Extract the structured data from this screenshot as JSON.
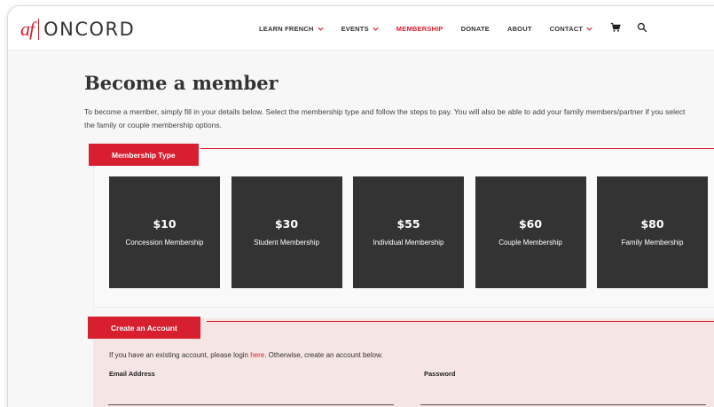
{
  "brand": {
    "logo_mark": "af",
    "logo_name": "ONCORD",
    "accent_color": "#d71f2f"
  },
  "nav": {
    "items": [
      {
        "label": "LEARN FRENCH",
        "dropdown": true,
        "active": false
      },
      {
        "label": "EVENTS",
        "dropdown": true,
        "active": false
      },
      {
        "label": "MEMBERSHIP",
        "dropdown": false,
        "active": true
      },
      {
        "label": "DONATE",
        "dropdown": false,
        "active": false
      },
      {
        "label": "ABOUT",
        "dropdown": false,
        "active": false
      },
      {
        "label": "CONTACT",
        "dropdown": true,
        "active": false
      }
    ],
    "cart_icon": "cart-icon",
    "search_icon": "search-icon"
  },
  "page": {
    "title": "Become a member",
    "intro": "To become a member, simply fill in your details below. Select the membership type and follow the steps to pay. You will also be able to add your family members/partner if you select the family or couple membership options."
  },
  "membership": {
    "tab_label": "Membership Type",
    "cards": [
      {
        "price": "$10",
        "name": "Concession Membership"
      },
      {
        "price": "$30",
        "name": "Student Membership"
      },
      {
        "price": "$55",
        "name": "Individual Membership"
      },
      {
        "price": "$60",
        "name": "Couple Membership"
      },
      {
        "price": "$80",
        "name": "Family Membership"
      }
    ]
  },
  "account": {
    "tab_label": "Create an Account",
    "text_before": "If you have an existing account, please login ",
    "link_text": "here",
    "text_after": ". Otherwise, create an account below.",
    "email_label": "Email Address",
    "email_value": "",
    "password_label": "Password",
    "password_value": ""
  }
}
